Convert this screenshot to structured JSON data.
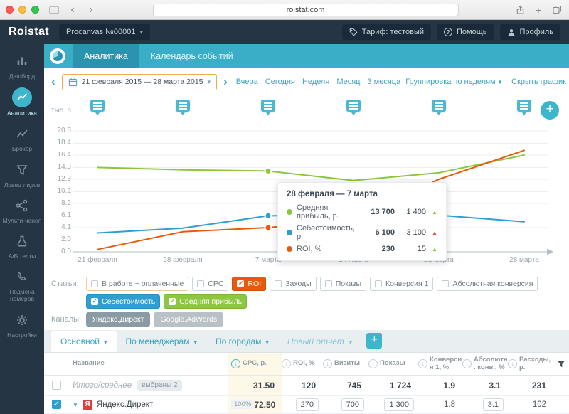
{
  "browser": {
    "url": "roistat.com"
  },
  "topbar": {
    "logo": "Roistat",
    "project": "Procanvas №00001",
    "tariff": "Тариф: тестовый",
    "help": "Помощь",
    "profile": "Профиль"
  },
  "sidebar": {
    "items": [
      {
        "label": "Дашборд"
      },
      {
        "label": "Аналитика"
      },
      {
        "label": "Брокер"
      },
      {
        "label": "Ловец лидов"
      },
      {
        "label": "Мульти-ченел"
      },
      {
        "label": "А/Б тесты"
      },
      {
        "label": "Подмена номеров"
      },
      {
        "label": "Настройки"
      }
    ]
  },
  "nav_tabs": {
    "analytics": "Аналитика",
    "calendar": "Календарь событий"
  },
  "controls": {
    "date_range": "21 февраля 2015 — 28 марта 2015",
    "quick_links": [
      "Вчера",
      "Сегодня",
      "Неделя",
      "Месяц",
      "3 месяца"
    ],
    "grouping": "Группировка по неделям",
    "hide_chart": "Скрыть график"
  },
  "chart_data": {
    "type": "line",
    "ylabel": "тыс. р.",
    "ylim": [
      0,
      20.5
    ],
    "y_ticks": [
      20.5,
      18.4,
      16.4,
      14.3,
      12.3,
      10.2,
      8.2,
      6.1,
      4.1,
      2.0,
      0.0
    ],
    "x_labels": [
      "21 февраля",
      "28 февраля",
      "7 марта",
      "14 марта",
      "21 марта",
      "28 марта"
    ],
    "grid": true,
    "legend_position": "none",
    "series": [
      {
        "name": "Средняя прибыль, р.",
        "color": "#8dc63f",
        "values": [
          14.3,
          13.9,
          13.7,
          12.1,
          13.4,
          16.4
        ]
      },
      {
        "name": "Себестоимость, р.",
        "color": "#2e9fd0",
        "values": [
          3.2,
          4.0,
          6.1,
          6.3,
          6.2,
          5.1
        ]
      },
      {
        "name": "ROI, %",
        "color": "#e8590c",
        "values": [
          0.4,
          3.4,
          4.1,
          5.4,
          12.3,
          17.2
        ]
      }
    ],
    "markers": [
      {
        "series": 0,
        "index": 2
      },
      {
        "series": 1,
        "index": 2
      },
      {
        "series": 2,
        "index": 2
      }
    ]
  },
  "tooltip": {
    "title": "28 февраля — 7 марта",
    "rows": [
      {
        "label": "Средняя прибыль, р.",
        "value": "13 700",
        "delta": "1 400",
        "direction": "up",
        "trend": "good"
      },
      {
        "label": "Себестоимость, р.",
        "value": "6 100",
        "delta": "3 100",
        "direction": "up",
        "trend": "bad"
      },
      {
        "label": "ROI, %",
        "value": "230",
        "delta": "15",
        "direction": "up",
        "trend": "good"
      }
    ]
  },
  "filters": {
    "articles_label": "Статьи:",
    "channels_label": "Каналы:",
    "row1": [
      {
        "label": "В работе + оплаченные",
        "checked": false
      },
      {
        "label": "CPC",
        "checked": false
      },
      {
        "label": "ROI",
        "checked": true,
        "color": "#e8590c"
      },
      {
        "label": "Заходы",
        "checked": false
      },
      {
        "label": "Показы",
        "checked": false
      },
      {
        "label": "Конверсия 1",
        "checked": false
      },
      {
        "label": "Абсолютная конверсия",
        "checked": false
      }
    ],
    "row2": [
      {
        "label": "Себестоимость",
        "checked": true,
        "color": "#2e9fd0"
      },
      {
        "label": "Средняя прибыль",
        "checked": true,
        "color": "#8dc63f"
      }
    ],
    "channels": [
      {
        "label": "Яндекс.Директ",
        "selected": true
      },
      {
        "label": "Google.AdWords",
        "selected": false
      }
    ]
  },
  "report_tabs": {
    "tabs": [
      {
        "label": "Основной",
        "active": true
      },
      {
        "label": "По менеджерам",
        "active": false
      },
      {
        "label": "По городам",
        "active": false
      },
      {
        "label": "Новый отчет",
        "active": false,
        "draft": true
      }
    ]
  },
  "table": {
    "columns": [
      "Название",
      "CPC, р.",
      "ROI, %",
      "Визиты",
      "Показы",
      "Конверсия 1, %",
      "Абсолютн. конв., %",
      "Расходы, р."
    ],
    "summary": {
      "name": "Итого/среднее",
      "badge": "выбраны 2",
      "cpc": "31.50",
      "roi": "120",
      "visits": "745",
      "shows": "1 724",
      "conv": "1.9",
      "abs_conv": "3.1",
      "expenses": "231"
    },
    "rows": [
      {
        "name": "Яндекс.Директ",
        "icon_letter": "Я",
        "percent": "100%",
        "cpc": "72.50",
        "roi": "270",
        "visits": "700",
        "shows": "1 300",
        "conv": "1.8",
        "abs_conv": "3.1",
        "expenses": "102"
      }
    ]
  }
}
